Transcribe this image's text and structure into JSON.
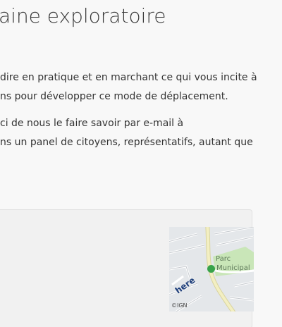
{
  "page": {
    "title": "aine exploratoire",
    "paragraph1": {
      "line1": "dire en pratique et en marchant ce qui vous incite à",
      "line2": "ns pour développer ce mode de déplacement."
    },
    "paragraph2": {
      "line1": "ci de nous le faire savoir par e-mail à",
      "line2": "ns un panel de citoyens, représentatifs, autant que"
    }
  },
  "map": {
    "park_label_line1": "Parc",
    "park_label_line2": "Municipal",
    "provider_logo": "here",
    "copyright": "©IGN",
    "colors": {
      "background": "#e4e7ea",
      "park": "#c9e6b8",
      "main_road": "#f3efc2",
      "pin": "#38a34a"
    }
  }
}
